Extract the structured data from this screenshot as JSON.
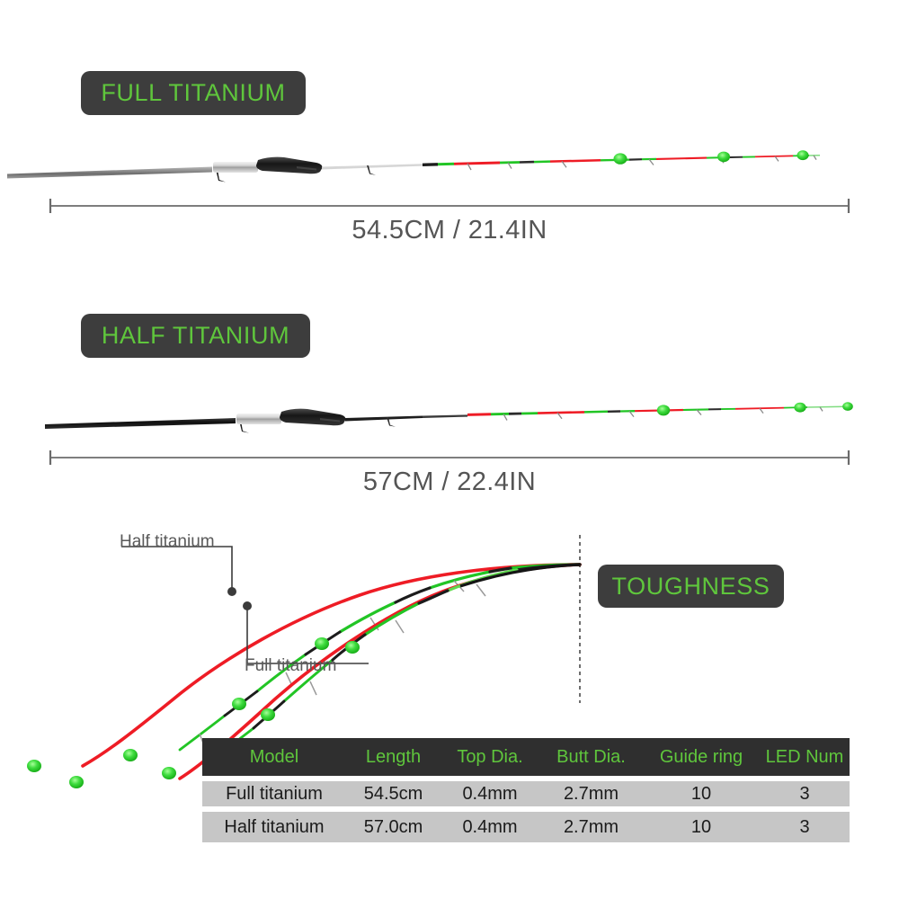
{
  "theme": {
    "accent_green": "#5fc63c",
    "badge_bg": "#3d3d3d",
    "table_header_bg": "#2f2f2f",
    "table_row_bg": "#c6c6c6",
    "rod_red": "#ee1c25",
    "rod_green": "#22c525",
    "led_green": "#3ddc3d",
    "page_bg": "#ffffff"
  },
  "sections": {
    "full_titanium": {
      "badge_label": "FULL TITANIUM",
      "dimension_label": "54.5CM / 21.4IN",
      "rod_name": "full-titanium-rod",
      "butt_color": "#8c8c8c",
      "led_count": 3
    },
    "half_titanium": {
      "badge_label": "HALF TITANIUM",
      "dimension_label": "57CM / 22.4IN",
      "rod_name": "half-titanium-rod",
      "butt_color": "#151515",
      "led_count": 3
    },
    "toughness": {
      "badge_label": "TOUGHNESS",
      "callout_half": "Half titanium",
      "callout_full": "Full titanium"
    }
  },
  "spec_table": {
    "headers": [
      "Model",
      "Length",
      "Top Dia.",
      "Butt Dia.",
      "Guide ring",
      "LED Num"
    ],
    "rows": [
      {
        "model": "Full titanium",
        "length": "54.5cm",
        "top_dia": "0.4mm",
        "butt_dia": "2.7mm",
        "guide_ring": "10",
        "led_num": "3"
      },
      {
        "model": "Half titanium",
        "length": "57.0cm",
        "top_dia": "0.4mm",
        "butt_dia": "2.7mm",
        "guide_ring": "10",
        "led_num": "3"
      }
    ]
  }
}
